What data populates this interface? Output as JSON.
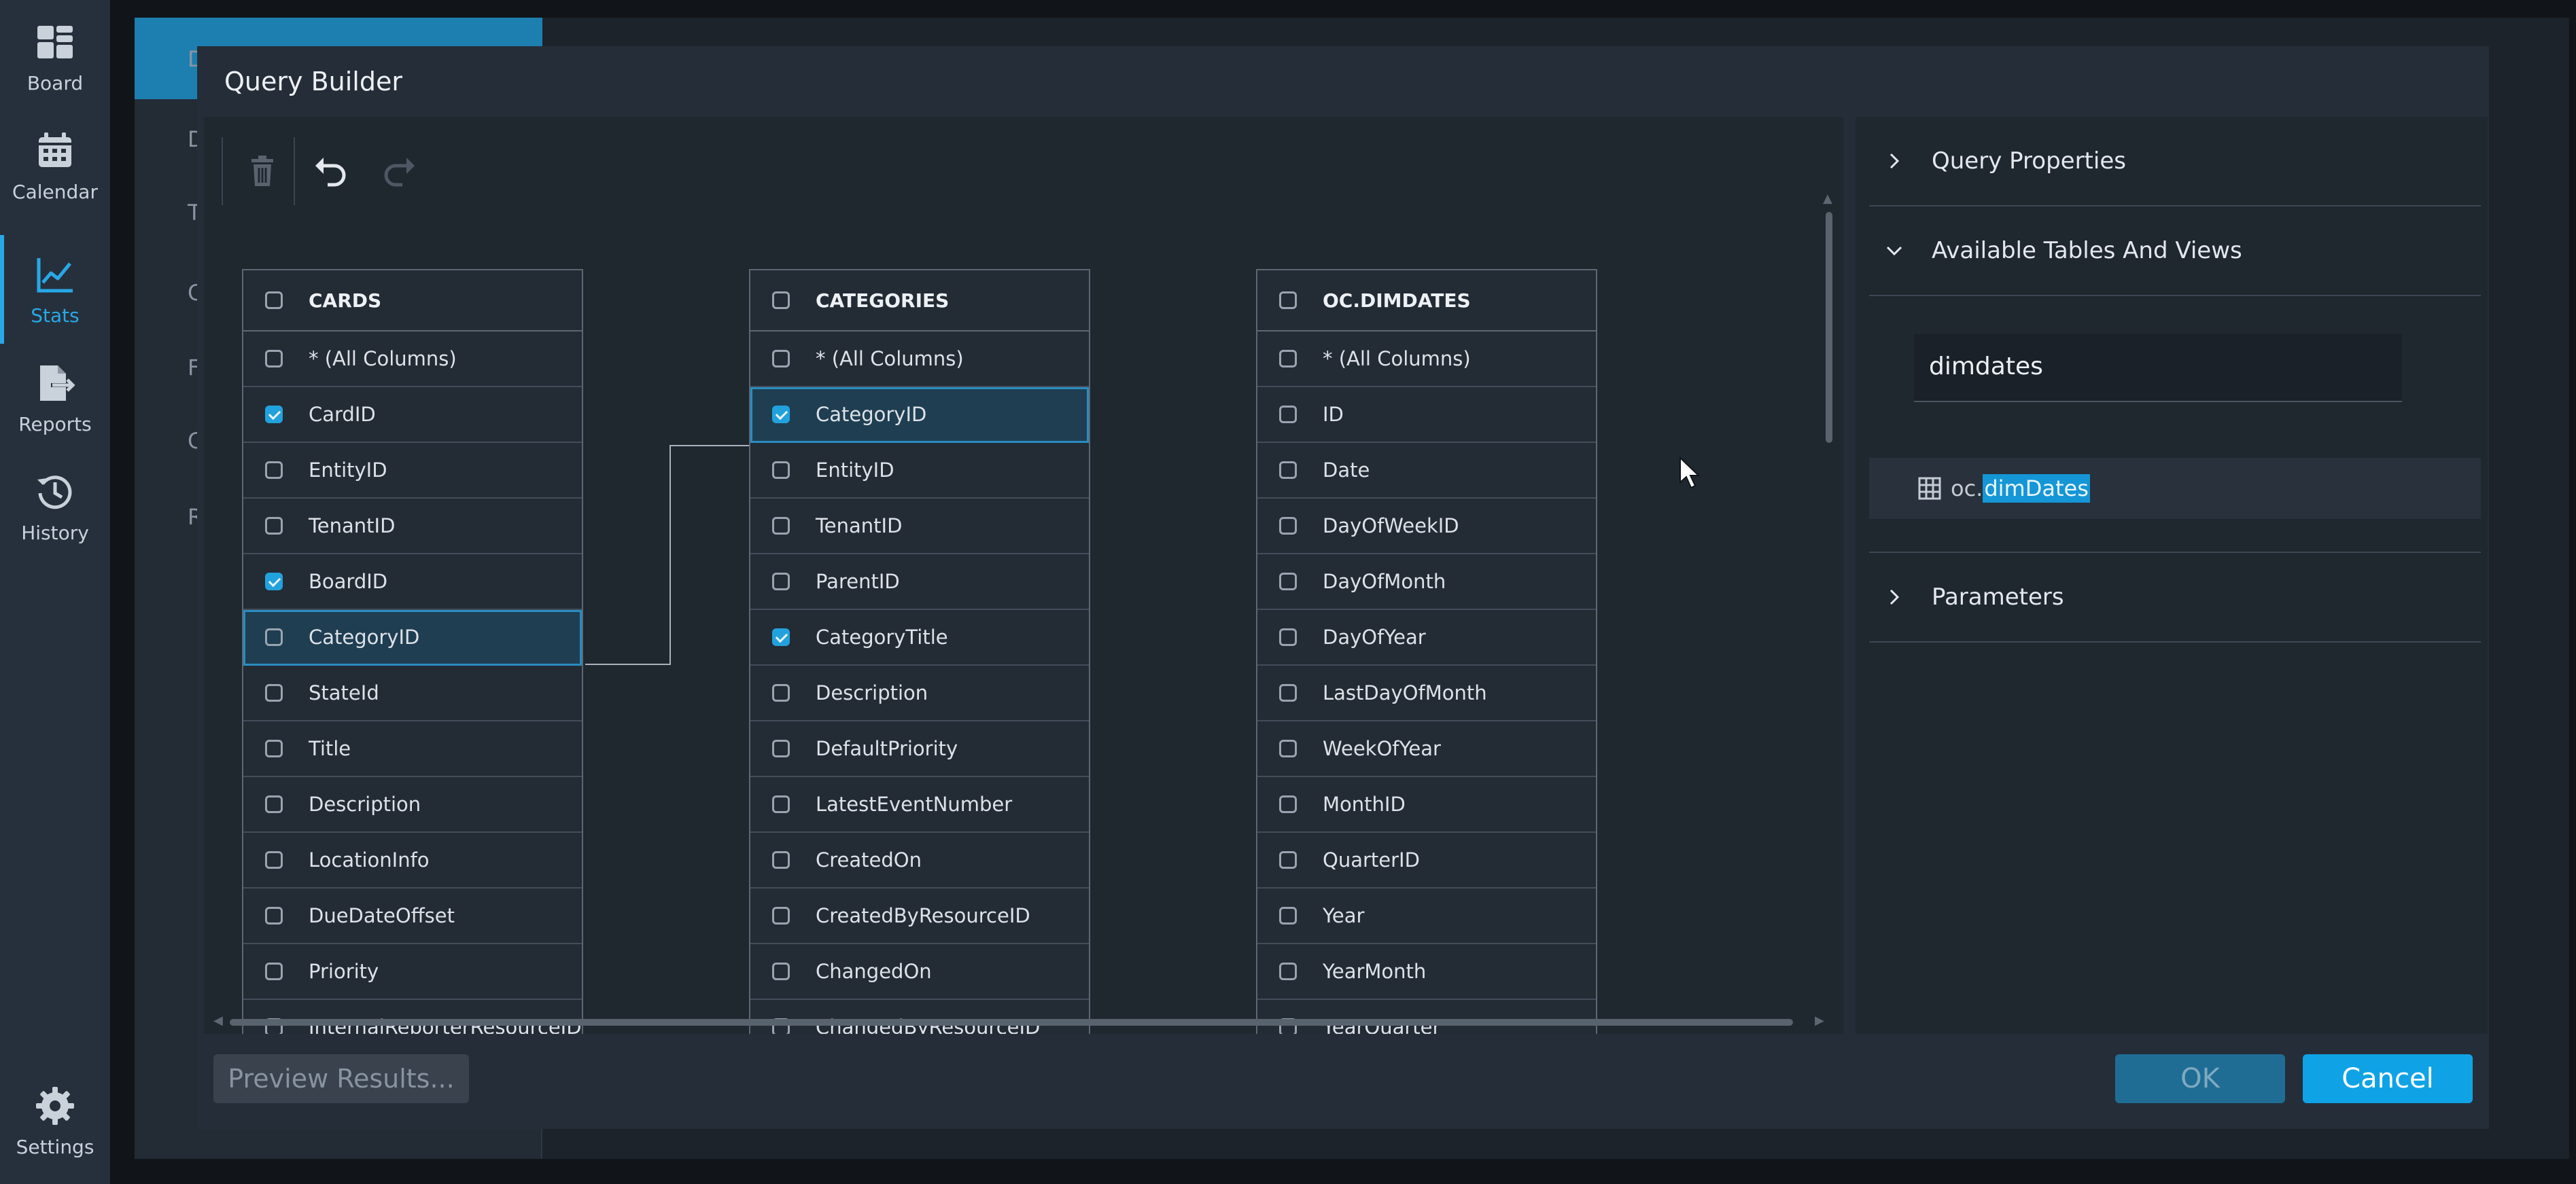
{
  "nav": {
    "items": [
      {
        "label": "Board",
        "icon": "board-icon"
      },
      {
        "label": "Calendar",
        "icon": "calendar-icon"
      },
      {
        "label": "Stats",
        "icon": "stats-icon",
        "active": true
      },
      {
        "label": "Reports",
        "icon": "reports-icon"
      },
      {
        "label": "History",
        "icon": "history-icon"
      }
    ],
    "settings": {
      "label": "Settings",
      "icon": "gear-icon"
    }
  },
  "background": {
    "letters": [
      "D",
      "D",
      "T",
      "C",
      "F",
      "C",
      "R"
    ]
  },
  "dialog": {
    "title": "Query Builder",
    "toolbar": {
      "delete_icon": "trash-icon",
      "undo_icon": "undo-icon",
      "redo_icon": "redo-icon"
    },
    "tables": [
      {
        "name": "CARDS",
        "columns": [
          {
            "label": "* (All Columns)",
            "checked": false
          },
          {
            "label": "CardID",
            "checked": true
          },
          {
            "label": "EntityID",
            "checked": false
          },
          {
            "label": "TenantID",
            "checked": false
          },
          {
            "label": "BoardID",
            "checked": true
          },
          {
            "label": "CategoryID",
            "checked": false,
            "selected": true
          },
          {
            "label": "StateId",
            "checked": false
          },
          {
            "label": "Title",
            "checked": false
          },
          {
            "label": "Description",
            "checked": false
          },
          {
            "label": "LocationInfo",
            "checked": false
          },
          {
            "label": "DueDateOffset",
            "checked": false
          },
          {
            "label": "Priority",
            "checked": false
          },
          {
            "label": "InternalReporterResourceID",
            "checked": false
          }
        ]
      },
      {
        "name": "CATEGORIES",
        "columns": [
          {
            "label": "* (All Columns)",
            "checked": false
          },
          {
            "label": "CategoryID",
            "checked": true,
            "selected": true
          },
          {
            "label": "EntityID",
            "checked": false
          },
          {
            "label": "TenantID",
            "checked": false
          },
          {
            "label": "ParentID",
            "checked": false
          },
          {
            "label": "CategoryTitle",
            "checked": true
          },
          {
            "label": "Description",
            "checked": false
          },
          {
            "label": "DefaultPriority",
            "checked": false
          },
          {
            "label": "LatestEventNumber",
            "checked": false
          },
          {
            "label": "CreatedOn",
            "checked": false
          },
          {
            "label": "CreatedByResourceID",
            "checked": false
          },
          {
            "label": "ChangedOn",
            "checked": false
          },
          {
            "label": "ChangedByResourceID",
            "checked": false
          }
        ]
      },
      {
        "name": "OC.DIMDATES",
        "columns": [
          {
            "label": "* (All Columns)",
            "checked": false
          },
          {
            "label": "ID",
            "checked": false
          },
          {
            "label": "Date",
            "checked": false
          },
          {
            "label": "DayOfWeekID",
            "checked": false
          },
          {
            "label": "DayOfMonth",
            "checked": false
          },
          {
            "label": "DayOfYear",
            "checked": false
          },
          {
            "label": "LastDayOfMonth",
            "checked": false
          },
          {
            "label": "WeekOfYear",
            "checked": false
          },
          {
            "label": "MonthID",
            "checked": false
          },
          {
            "label": "QuarterID",
            "checked": false
          },
          {
            "label": "Year",
            "checked": false
          },
          {
            "label": "YearMonth",
            "checked": false
          },
          {
            "label": "YearQuarter",
            "checked": false
          }
        ]
      }
    ],
    "side": {
      "query_properties": "Query Properties",
      "available_tables": "Available Tables And Views",
      "search_value": "dimdates",
      "result_prefix": "oc.",
      "result_match": "dimDates",
      "parameters": "Parameters"
    },
    "footer": {
      "preview": "Preview Results...",
      "ok": "OK",
      "cancel": "Cancel"
    }
  }
}
